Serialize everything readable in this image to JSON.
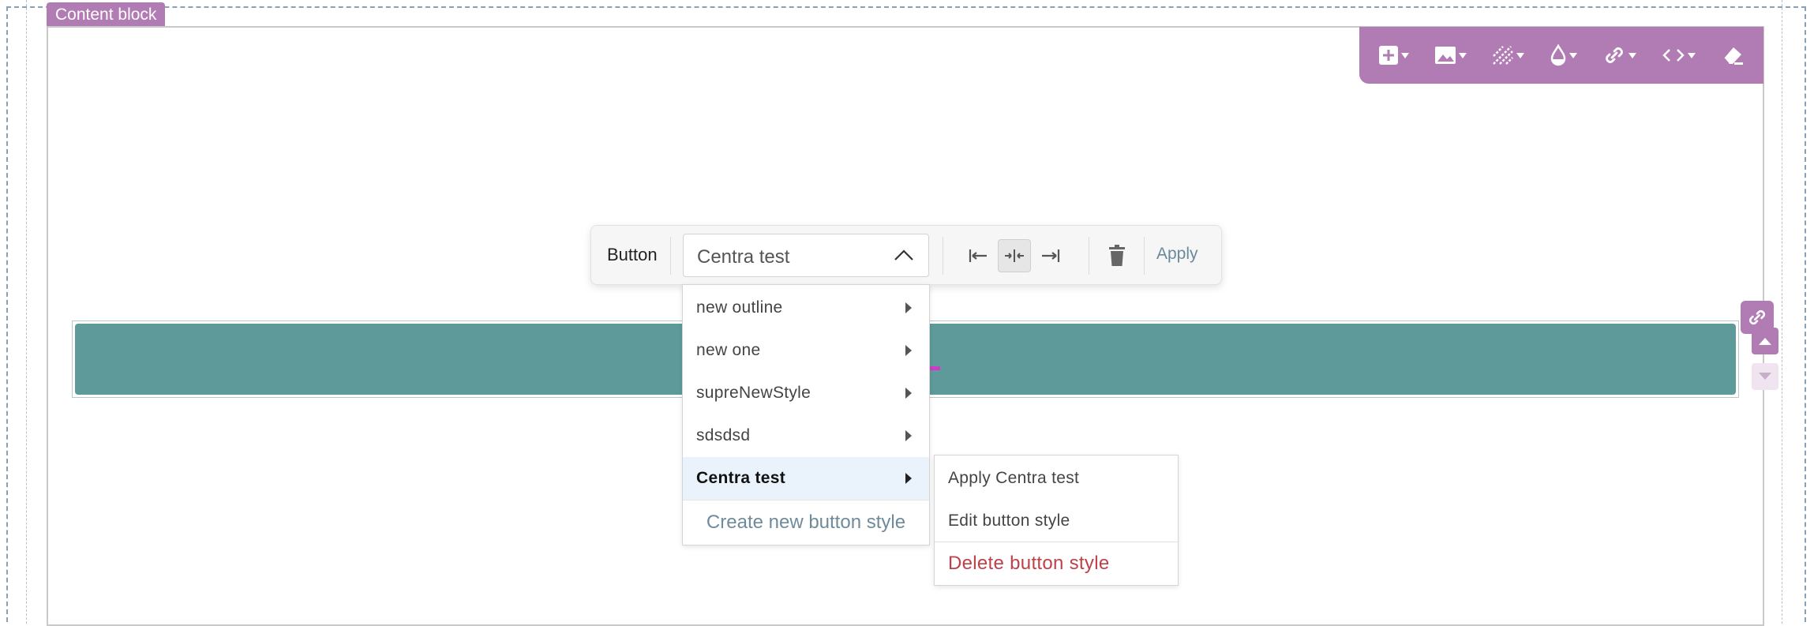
{
  "content_block": {
    "tab_label": "Content block"
  },
  "block_toolbar": {
    "items": [
      "add-icon",
      "image-icon",
      "pattern-icon",
      "color-drop-icon",
      "link-icon",
      "code-icon",
      "eraser-icon"
    ]
  },
  "button_toolbar": {
    "label": "Button",
    "selected_style": "Centra test",
    "apply_label": "Apply"
  },
  "button_preview": {
    "visible_text": "EL",
    "bg_color": "#5f9a9a",
    "text_color": "#d438c8"
  },
  "dropdown": {
    "items": [
      {
        "label": "new outline"
      },
      {
        "label": "new one"
      },
      {
        "label": "supreNewStyle"
      },
      {
        "label": "sdsdsd"
      },
      {
        "label": "Centra test",
        "selected": true
      }
    ],
    "create_label": "Create new button style"
  },
  "submenu": {
    "apply_label": "Apply Centra test",
    "edit_label": "Edit button style",
    "delete_label": "Delete button style"
  },
  "colors": {
    "accent": "#b17bb4",
    "danger": "#c0404a",
    "link": "#6f8b9b"
  }
}
